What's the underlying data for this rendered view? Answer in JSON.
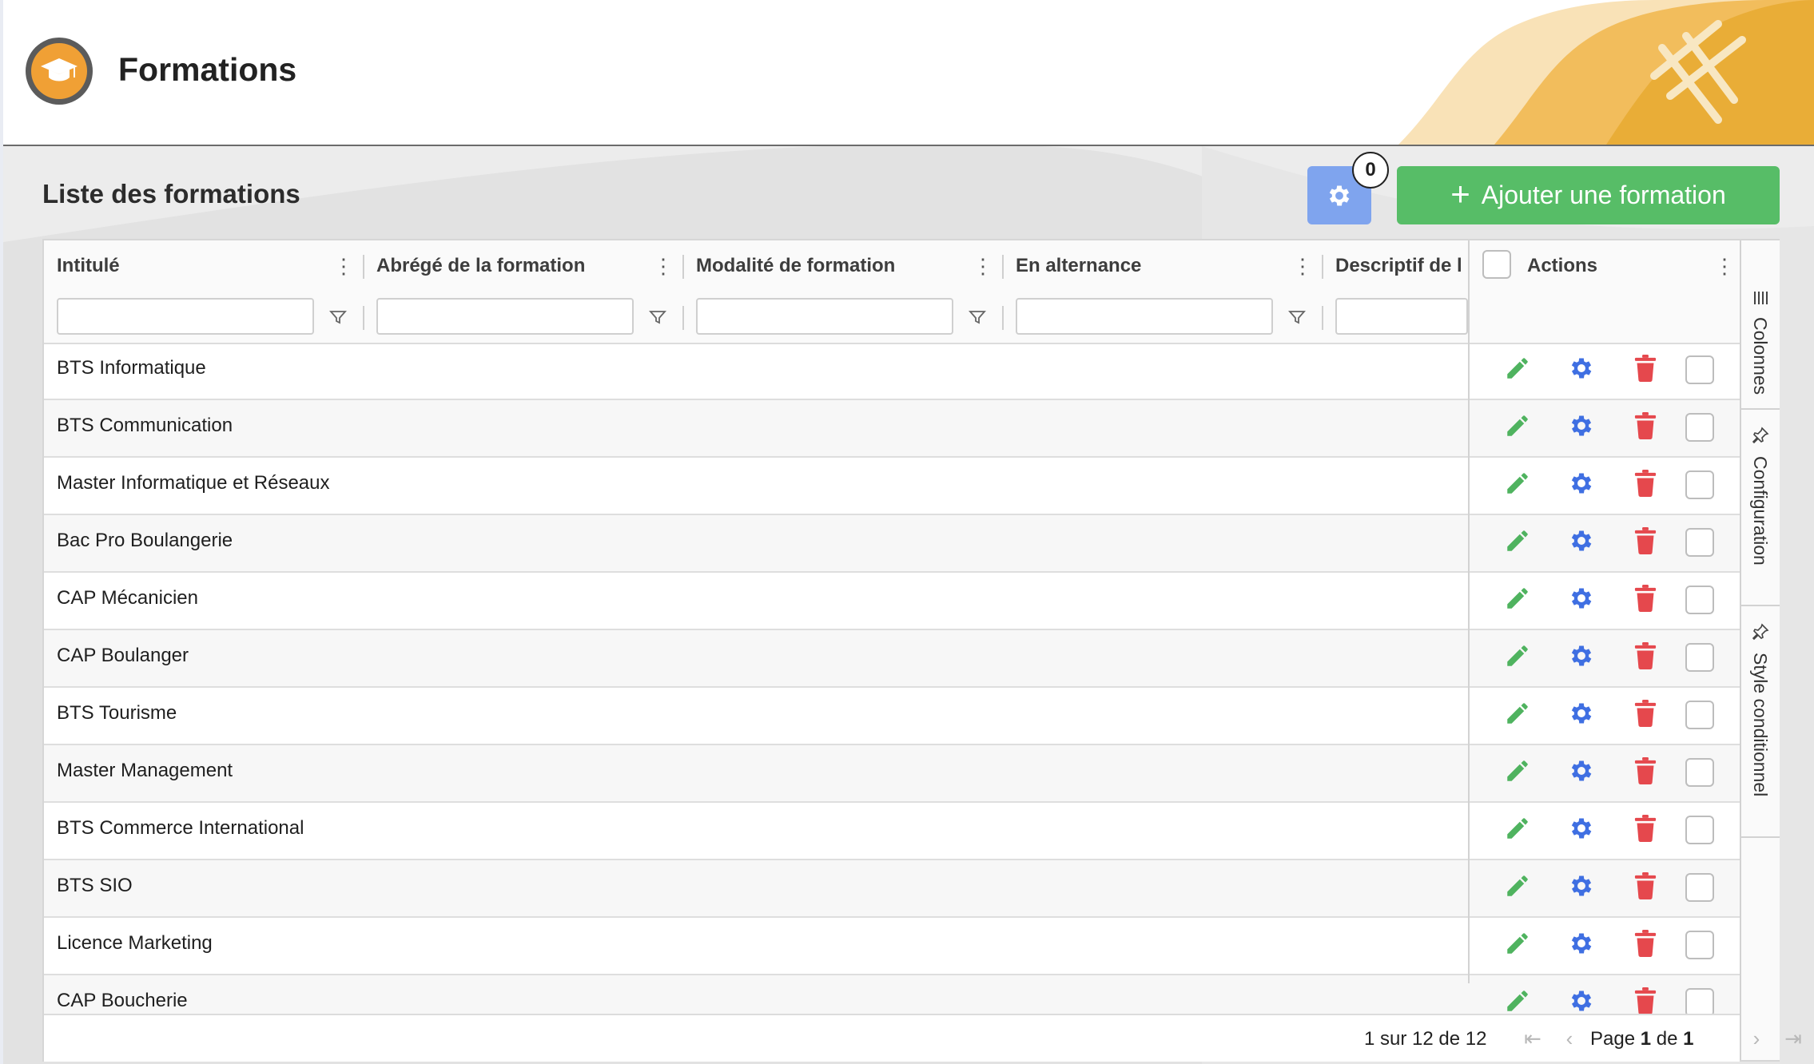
{
  "app": {
    "title": "Formations"
  },
  "toolbar": {
    "settings_badge": "0",
    "add_label": "Ajouter une formation"
  },
  "list": {
    "title": "Liste des formations"
  },
  "grid": {
    "columns": [
      "Intitulé",
      "Abrégé de la formation",
      "Modalité de formation",
      "En alternance",
      "Descriptif de l"
    ],
    "actions_header": "Actions",
    "rows": [
      "BTS Informatique",
      "BTS Communication",
      "Master Informatique et Réseaux",
      "Bac Pro Boulangerie",
      "CAP Mécanicien",
      "CAP Boulanger",
      "BTS Tourisme",
      "Master Management",
      "BTS Commerce International",
      "BTS SIO",
      "Licence Marketing",
      "CAP Boucherie"
    ],
    "side_tabs": [
      "Colonnes",
      "Configuration",
      "Style conditionnel"
    ],
    "pagination": {
      "count_text": "1 sur 12 de 12",
      "page_prefix": "Page",
      "page_current": "1",
      "page_sep": "de",
      "page_total": "1"
    }
  },
  "colors": {
    "accent_green": "#57bd67",
    "accent_blue": "#4a74e8",
    "delete_red": "#e5484d",
    "logo_orange": "#f0a035"
  }
}
